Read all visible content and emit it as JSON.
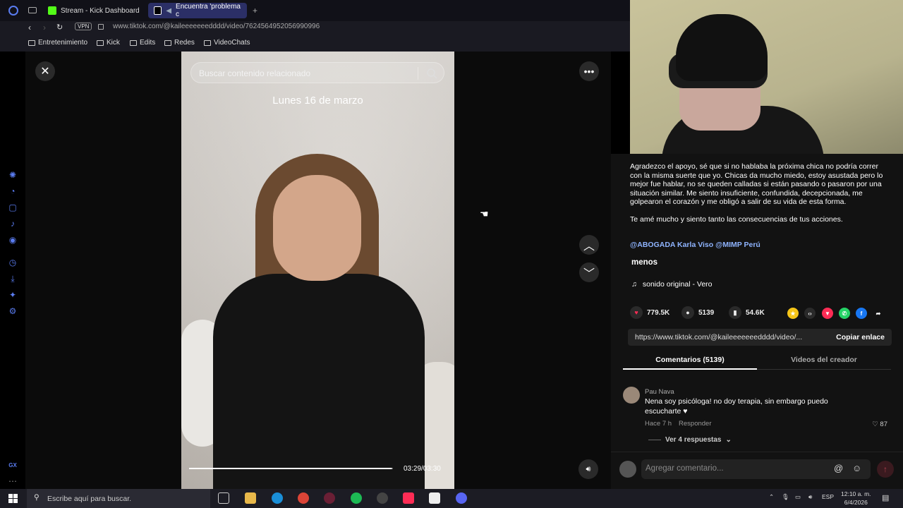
{
  "browser": {
    "tabs": [
      {
        "label": "Stream - Kick Dashboard"
      },
      {
        "label": "Encuentra 'problema c"
      }
    ],
    "vpn_label": "VPN",
    "url": "www.tiktok.com/@kaileeeeeeedddd/video/7624564952056990996",
    "bookmarks": [
      "Entretenimiento",
      "Kick",
      "Edits",
      "Redes",
      "VideoChats"
    ]
  },
  "video": {
    "search_placeholder": "Buscar contenido relacionado",
    "caption": "Lunes 16 de marzo",
    "time": "03:29/03:30",
    "progress": 0.995
  },
  "description": {
    "paragraph1": "Agradezco el apoyo, sé que si no hablaba la próxima chica no podría correr con la misma suerte que yo. Chicas da mucho miedo, estoy asustada pero lo mejor fue hablar, no se queden calladas si están pasando o pasaron por una situación similar. Me siento insuficiente, confundida, decepcionada, me golpearon el corazón y me obligó a salir de su vida de esta forma.",
    "paragraph2": "Te amé mucho y siento tanto las consecuencias de tus acciones.",
    "mentions": "@ABOGADA Karla Viso @MIMP Perú",
    "less": "menos",
    "sound": "sonido original - Vero"
  },
  "stats": {
    "likes": "779.5K",
    "comments": "5139",
    "saves": "54.6K"
  },
  "share": {
    "link": "https://www.tiktok.com/@kaileeeeeeedddd/video/...",
    "copy_label": "Copiar enlace"
  },
  "panel_tabs": {
    "comments": "Comentarios (5139)",
    "creator_videos": "Videos del creador"
  },
  "comment": {
    "author": "Pau Nava",
    "text": "Nena soy psicóloga! no doy terapia, sin embargo puedo escucharte ♥",
    "time": "Hace 7 h",
    "reply": "Responder",
    "likes": "87",
    "view_replies": "Ver 4 respuestas"
  },
  "add_comment": {
    "placeholder": "Agregar comentario..."
  },
  "taskbar": {
    "search_placeholder": "Escribe aquí para buscar.",
    "lang": "ESP",
    "time": "12:10 a. m.",
    "date": "6/4/2026"
  },
  "sidebar_bottom": "GX",
  "colors": {
    "accent_blue": "#5a7cf0",
    "like_pink": "#fe2c55",
    "mention_blue": "#8fb4ff"
  }
}
